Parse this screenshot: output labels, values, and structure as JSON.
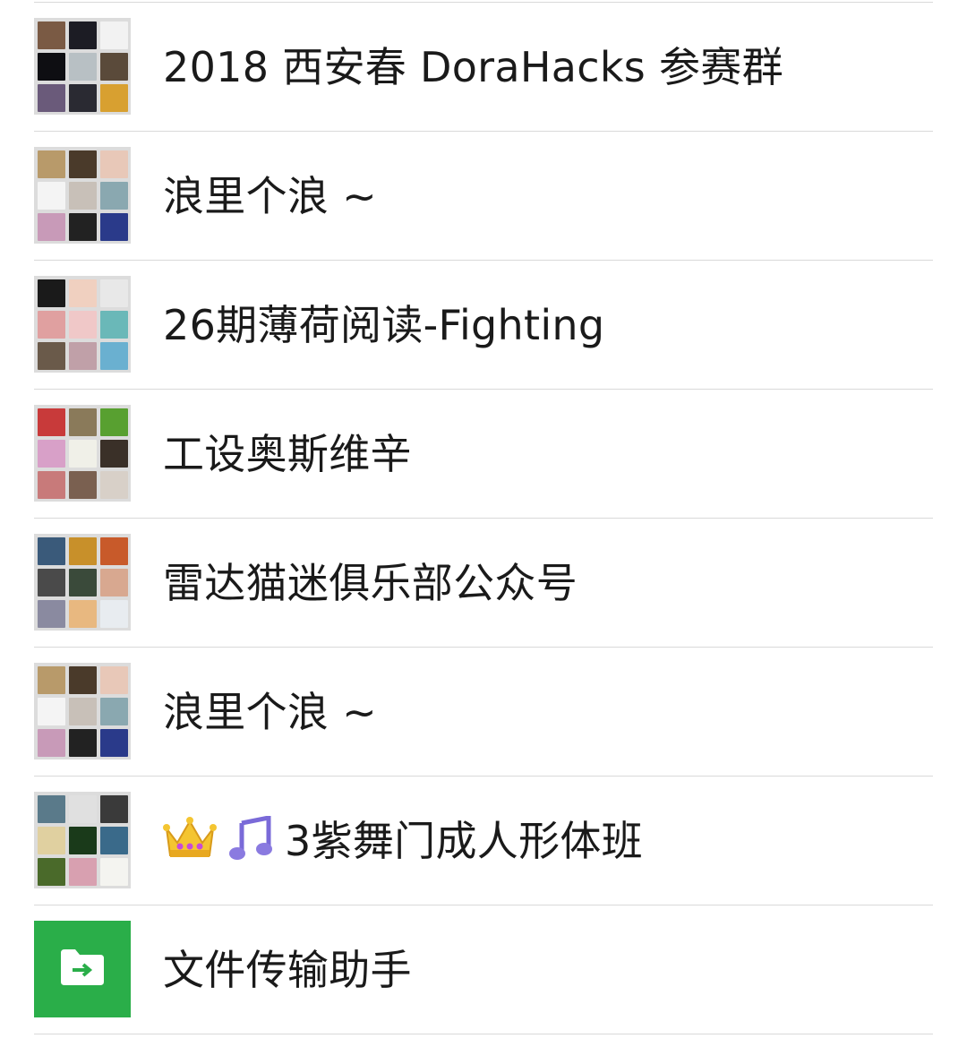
{
  "chats": [
    {
      "title": "2018 西安春 DoraHacks 参赛群",
      "avatar_colors": [
        "#7a5a44",
        "#1c1c24",
        "#f2f2f2",
        "#0e0e12",
        "#b8c0c4",
        "#5a4a3a",
        "#6a5a7a",
        "#2a2a32",
        "#d8a030"
      ]
    },
    {
      "title": "浪里个浪 ~",
      "avatar_colors": [
        "#b89a6a",
        "#4a3a2a",
        "#e8c8b8",
        "#f4f4f4",
        "#c8c0b8",
        "#8aa8b0",
        "#c89ab8",
        "#222222",
        "#2a3a8a"
      ]
    },
    {
      "title": "26期薄荷阅读-Fighting",
      "avatar_colors": [
        "#1a1a1a",
        "#f0d0c0",
        "#e8e8e8",
        "#e0a0a0",
        "#f0c8c8",
        "#6ab8b8",
        "#6a5a4a",
        "#c0a0a8",
        "#6ab0d0"
      ]
    },
    {
      "title": "工设奥斯维辛",
      "avatar_colors": [
        "#c83a3a",
        "#8a7a5a",
        "#58a030",
        "#d8a0c8",
        "#f0f0e8",
        "#3a3028",
        "#c87a7a",
        "#7a6050",
        "#d8d0c8"
      ]
    },
    {
      "title": "雷达猫迷俱乐部公众号",
      "avatar_colors": [
        "#3a5a7a",
        "#c8902a",
        "#c85a2a",
        "#4a4a4a",
        "#3a4a3a",
        "#d8a890",
        "#8a8aa0",
        "#e8b880",
        "#e8ecf0"
      ]
    },
    {
      "title": "浪里个浪 ~",
      "avatar_colors": [
        "#b89a6a",
        "#4a3a2a",
        "#e8c8b8",
        "#f4f4f4",
        "#c8c0b8",
        "#8aa8b0",
        "#c89ab8",
        "#222222",
        "#2a3a8a"
      ]
    },
    {
      "title": "3紫舞门成人形体班",
      "title_emojis": [
        "crown-emoji",
        "music-note-emoji"
      ],
      "avatar_colors": [
        "#5a7a8a",
        "#e0e0e0",
        "#3a3a3a",
        "#e0d0a0",
        "#1a3a1a",
        "#3a6a8a",
        "#4a6a2a",
        "#d8a0b0",
        "#f4f4f0"
      ]
    },
    {
      "title": "文件传输助手",
      "avatar_icon": "folder-transfer-icon",
      "avatar_color": "#2aae49"
    }
  ],
  "colors": {
    "divider": "#d9d9d9",
    "text": "#1a1a1a",
    "file_transfer_green": "#2aae49"
  }
}
